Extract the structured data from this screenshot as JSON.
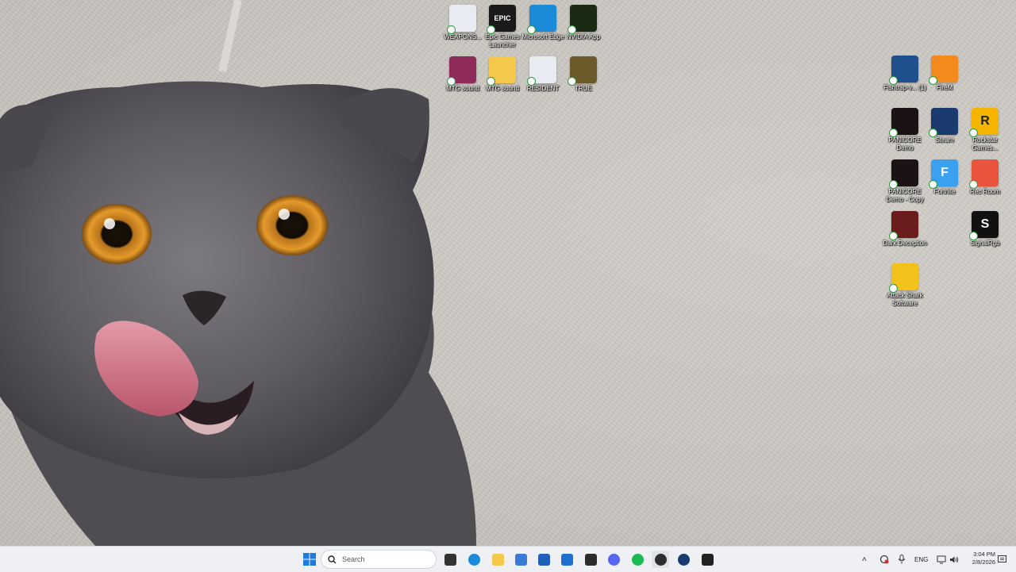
{
  "desktop": {
    "icons": [
      {
        "label": "WEAPONS...",
        "icon": "document-shortcut-icon",
        "color": "#e8ecf2"
      },
      {
        "label": "Epic Games Launcher",
        "icon": "epic-games-icon",
        "color": "#1a1a1a",
        "glyph": "EPIC"
      },
      {
        "label": "Microsoft Edge",
        "icon": "edge-icon",
        "color": "#1b8ad8"
      },
      {
        "label": "NVIDIA App",
        "icon": "nvidia-icon",
        "color": "#1b2a12"
      },
      {
        "label": "MTG sound",
        "icon": "winrar-icon",
        "color": "#8e2b5b"
      },
      {
        "label": "MTG sound",
        "icon": "folder-icon",
        "color": "#f4c84a"
      },
      {
        "label": "RESIDENT",
        "icon": "document-shortcut-icon",
        "color": "#e8ecf2"
      },
      {
        "label": "TRUE",
        "icon": "true-app-icon",
        "color": "#6b5a2a"
      },
      {
        "label": "Fishtrap-v... (1)",
        "icon": "fishtrap-icon",
        "color": "#1f4f8c"
      },
      {
        "label": "FireM",
        "icon": "firem-icon",
        "color": "#f28a1d"
      },
      {
        "label": "PANICORE Demo",
        "icon": "panicore-icon",
        "color": "#1a1214"
      },
      {
        "label": "Steam",
        "icon": "steam-icon",
        "color": "#1b3b6f"
      },
      {
        "label": "Rockstar Games...",
        "icon": "rockstar-icon",
        "color": "#f4b400",
        "glyph": "R"
      },
      {
        "label": "PANICORE Demo - Copy",
        "icon": "panicore-icon",
        "color": "#1a1214"
      },
      {
        "label": "Fortnite",
        "icon": "fortnite-icon",
        "color": "#3aa0f0",
        "glyph": "F"
      },
      {
        "label": "Rec Room",
        "icon": "rec-room-icon",
        "color": "#e8553c"
      },
      {
        "label": "Dark Deception",
        "icon": "dark-deception-icon",
        "color": "#6b1d1d"
      },
      {
        "label": "SignalRgb",
        "icon": "signalrgb-icon",
        "color": "#111111",
        "glyph": "S"
      },
      {
        "label": "Attack Shark Software",
        "icon": "attack-shark-icon",
        "color": "#f2c21a"
      }
    ]
  },
  "taskbar": {
    "search_placeholder": "Search",
    "pinned": [
      {
        "icon": "task-view-icon",
        "color": "#333333"
      },
      {
        "icon": "edge-icon",
        "color": "#1b8ad8"
      },
      {
        "icon": "file-explorer-icon",
        "color": "#f4c84a"
      },
      {
        "icon": "store-icon",
        "color": "#3a7bd5"
      },
      {
        "icon": "calculator-icon",
        "color": "#2160b8"
      },
      {
        "icon": "outlook-icon",
        "color": "#1f6fd1"
      },
      {
        "icon": "epic-games-icon",
        "color": "#2b2b2b"
      },
      {
        "icon": "discord-icon",
        "color": "#5865f2"
      },
      {
        "icon": "spotify-icon",
        "color": "#1db954"
      },
      {
        "icon": "obs-icon",
        "color": "#2d2d2d"
      },
      {
        "icon": "steam-icon",
        "color": "#1b3b6f"
      },
      {
        "icon": "app-icon",
        "color": "#222222"
      }
    ],
    "tray": {
      "language": "ENG",
      "time": "3:04 PM",
      "date": "2/8/2026"
    }
  }
}
